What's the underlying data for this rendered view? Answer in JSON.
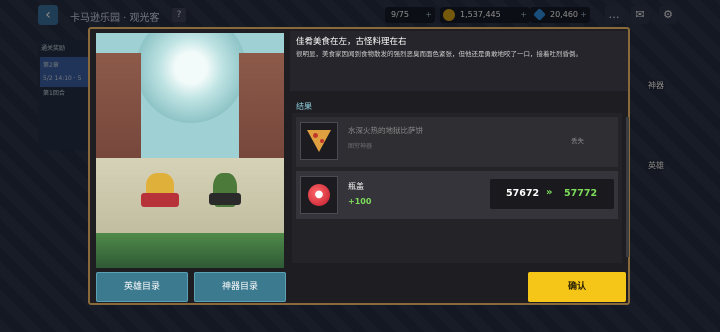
{
  "topbar": {
    "back_icon": "back-arrow-icon",
    "park_title": "卡马逊乐园 · 观光客",
    "help_label": "?",
    "count": "9/75",
    "gold": "1,537,445",
    "gems": "20,460"
  },
  "background": {
    "left_panel_title": "通关奖励",
    "left_panel_line1": "第2章",
    "left_panel_line2": "5/2 14:10 · 5",
    "left_panel_line3": "第1回合",
    "right_label_artifacts": "神器",
    "right_label_heroes": "英雄"
  },
  "modal": {
    "story": {
      "title": "佳肴美食在左，古怪料理在右",
      "text": "很明显，美食家因闻到食物散发的强烈恶臭而面色紧张，但他还是勇敢地咬了一口，接着吐烈昏倒。"
    },
    "result_label": "结果",
    "results": [
      {
        "icon": "pizza-slice-icon",
        "name": "水深火热的地狱比萨饼",
        "sub": "图穷神器",
        "status": "丢失"
      },
      {
        "icon": "bottle-cap-icon",
        "name": "瓶盖",
        "delta": "+100",
        "old_value": "57672",
        "arrow": "»",
        "new_value": "57772"
      }
    ],
    "buttons": {
      "heroes": "英雄目录",
      "artifacts": "神器目录",
      "confirm": "确认"
    }
  },
  "colors": {
    "confirm_yellow": "#f5c518",
    "teal_button": "#3c7a8f",
    "gain_green": "#7ddc5a",
    "frame_gold": "#8a6a3a"
  }
}
